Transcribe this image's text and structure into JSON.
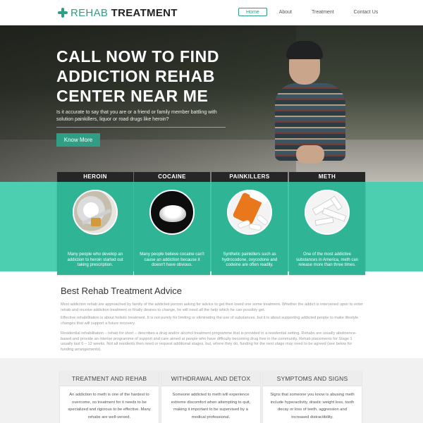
{
  "header": {
    "logo_light": "REHAB",
    "logo_bold": "TREATMENT",
    "nav": [
      {
        "label": "Home",
        "active": true
      },
      {
        "label": "About",
        "active": false
      },
      {
        "label": "Treatment",
        "active": false
      },
      {
        "label": "Contact Us",
        "active": false
      }
    ]
  },
  "hero": {
    "title_line1": "CALL NOW TO FIND",
    "title_line2": "ADDICTION REHAB",
    "title_line3": "CENTER NEAR ME",
    "subtitle": "Is it accurate to say that you are or a friend or family member battling with solution painkillers, liquor or road drugs like heroin?",
    "button": "Know More"
  },
  "drugs": [
    {
      "title": "HEROIN",
      "text": "Many people who develop an addiction to heroin started out taking prescription."
    },
    {
      "title": "COCAINE",
      "text": "Many people believe cocaine can't cause an addiction because it doesn't have obvious."
    },
    {
      "title": "PAINKILLERS",
      "text": "Synthetic painkillers such as hydrocodone, oxycodone and codeine are often readily."
    },
    {
      "title": "METH",
      "text": "One of the most addictive substances in America, meth can release more than three times."
    }
  ],
  "advice": {
    "title": "Best Rehab Treatment Advice",
    "paragraphs": [
      "Most addiction rehab are approached by family of the addicted person asking for advice to get their loved one some treatment. Whether the addict is intervened upon to enter rehab and receive addiction treatment or finally desires to change, he will need all the help which he can possibly get.",
      "Effective rehabilitation is about holistic treatment. It is not purely for limiting or eliminating the use of substances, but it is about supporting addicted people to make lifestyle changes that will support a future recovery.",
      "Residential rehabilitation – rehab for short – describes a drug and/or alcohol treatment programme that is provided in a residential setting. Rehabs are usually abstinence-based and provide an intense programme of support and care aimed at people who have difficulty becoming drug free in the community. Rehab placements for Stage 1 usually last 6 – 12 weeks. Not all residents then need or request additional stages, but, where they do, funding for the next stage may need to be agreed (see below for funding arrangements)."
    ]
  },
  "info_cards": [
    {
      "title": "TREATMENT AND REHAB",
      "text": "An addiction to meth is one of the hardest to overcome, so treatment for it needs to be specialized and rigorous to be effective. Many rehabs are well-versed."
    },
    {
      "title": "WITHDRAWAL AND DETOX",
      "text": "Someone addicted to meth will experience extreme discomfort when attempting to quit, making it important to be supervised by a medical professional."
    },
    {
      "title": "SYMPTOMS AND SIGNS",
      "text": "Signs that someone you know is abusing meth include hyperactivity, drastic weight loss, tooth decay or loss of teeth, aggression and increased distractibility."
    }
  ],
  "colors": {
    "accent": "#2f9e84",
    "band": "#4bcfb0",
    "card": "#2fb596",
    "card_head": "#262626"
  },
  "icons": [
    "logo-cross-icon"
  ]
}
